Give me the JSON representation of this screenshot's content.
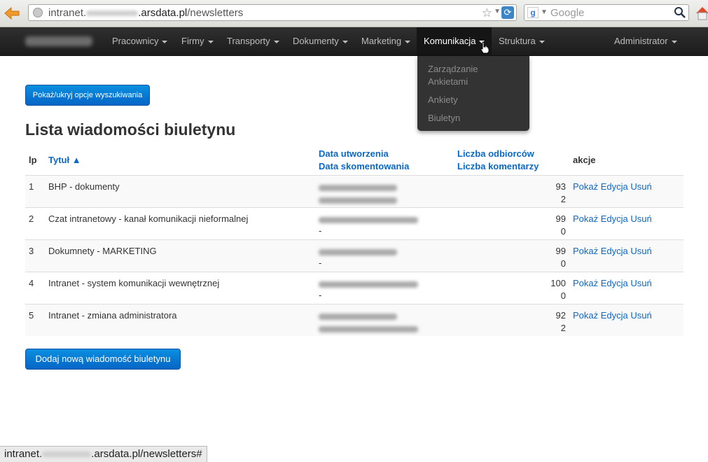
{
  "browser": {
    "url_prefix": "intranet.",
    "url_domain": ".arsdata.pl",
    "url_path": "/newsletters",
    "search_placeholder": "Google",
    "google_letter": "g",
    "reload_glyph": "⟳"
  },
  "navbar": {
    "items": [
      {
        "label": "Pracownicy"
      },
      {
        "label": "Firmy"
      },
      {
        "label": "Transporty"
      },
      {
        "label": "Dokumenty"
      },
      {
        "label": "Marketing"
      },
      {
        "label": "Komunikacja"
      },
      {
        "label": "Struktura"
      }
    ],
    "user_menu": "Administrator"
  },
  "dropdown": {
    "items": [
      {
        "line1": "Zarządzanie",
        "line2": "Ankietami"
      },
      {
        "line1": "Ankiety"
      },
      {
        "line1": "Biuletyn"
      }
    ]
  },
  "content": {
    "toggle_search_label": "Pokaż/ukryj opcje wyszukiwania",
    "title": "Lista wiadomości biuletynu",
    "add_button_label": "Dodaj nową wiadomość biuletynu"
  },
  "table": {
    "headers": {
      "lp": "lp",
      "title": "Tytuł ▲",
      "date_created": "Data utworzenia",
      "date_commented": "Data skomentowania",
      "recipients": "Liczba odbiorców",
      "comments": "Liczba komentarzy",
      "actions": "akcje"
    },
    "action_labels": {
      "show": "Pokaż",
      "edit": "Edycja",
      "delete": "Usuń"
    },
    "rows": [
      {
        "lp": "1",
        "title": "BHP - dokumenty",
        "date_commented": "",
        "recipients": "93",
        "comments": "2"
      },
      {
        "lp": "2",
        "title": "Czat intranetowy - kanał komunikacji nieformalnej",
        "date_commented": "-",
        "recipients": "99",
        "comments": "0"
      },
      {
        "lp": "3",
        "title": "Dokumnety - MARKETING",
        "date_commented": "-",
        "recipients": "99",
        "comments": "0"
      },
      {
        "lp": "4",
        "title": "Intranet - system komunikacji wewnętrznej",
        "date_commented": "-",
        "recipients": "100",
        "comments": "0"
      },
      {
        "lp": "5",
        "title": "Intranet - zmiana administratora",
        "date_commented": "",
        "recipients": "92",
        "comments": "2"
      }
    ]
  },
  "statusbar": {
    "url_prefix": "intranet.",
    "url_suffix": ".arsdata.pl/newsletters#"
  },
  "colors": {
    "link": "#0a68c7",
    "navbar_bg": "#222222",
    "dropdown_bg": "#333333",
    "primary_button": "#0674d3"
  }
}
